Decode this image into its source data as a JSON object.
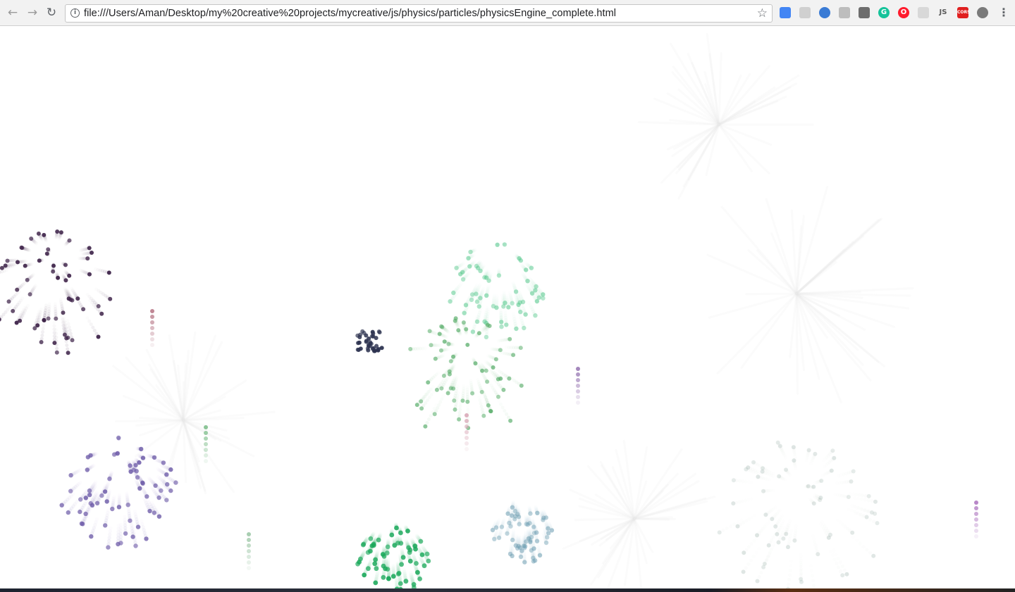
{
  "browser": {
    "back_glyph": "←",
    "forward_glyph": "→",
    "reload_glyph": "↻",
    "info_glyph": "i",
    "address": "file:///Users/Aman/Desktop/my%20creative%20projects/mycreative/js/physics/particles/physicsEngine_complete.html",
    "bookmark_glyph": "☆",
    "menu_glyph": "⋮",
    "extensions": [
      {
        "name": "google-translate-icon",
        "color": "#4285f4"
      },
      {
        "name": "puzzle-extension-icon",
        "color": "#d0d0d0"
      },
      {
        "name": "globe-extension-icon",
        "color": "#3a7bd5"
      },
      {
        "name": "shield-extension-icon",
        "color": "#bdbdbd"
      },
      {
        "name": "link-extension-icon",
        "color": "#6d6d6d"
      },
      {
        "name": "grammarly-icon",
        "color": "#15c39a",
        "label": "G"
      },
      {
        "name": "opera-icon",
        "color": "#ff1b2d",
        "label": "O"
      },
      {
        "name": "grid-extension-icon",
        "color": "#d8d8d8"
      },
      {
        "name": "js-extension-icon",
        "color": "#5a5a5a",
        "label": "JS"
      },
      {
        "name": "cors-extension-icon",
        "color": "#e02020",
        "label": "CORS"
      },
      {
        "name": "web-extension-icon",
        "color": "#7a7a7a"
      }
    ]
  },
  "fireworks": [
    {
      "name": "firework-dark-purple",
      "color": "#3d2248",
      "opacity": 0.95,
      "count": 60
    },
    {
      "name": "firework-mint",
      "color": "#59c98f",
      "opacity": 0.6,
      "count": 62
    },
    {
      "name": "firework-green",
      "color": "#5aae6c",
      "opacity": 0.75,
      "count": 64
    },
    {
      "name": "firework-navy-cluster",
      "color": "#2d3350",
      "opacity": 0.95,
      "count": 40
    },
    {
      "name": "firework-lavender",
      "color": "#6d5ba8",
      "opacity": 0.85,
      "count": 66
    },
    {
      "name": "firework-bright-green",
      "color": "#1aa85a",
      "opacity": 0.9,
      "count": 60
    },
    {
      "name": "firework-slate-blue",
      "color": "#6f9fb3",
      "opacity": 0.6,
      "count": 58
    },
    {
      "name": "firework-faded-gray",
      "color": "#9fb4ad",
      "opacity": 0.35,
      "count": 64
    }
  ],
  "colors": {
    "toolbar": "#f2f2f2",
    "canvas": "#ffffff",
    "faint_trail": "#e9e9e9"
  }
}
